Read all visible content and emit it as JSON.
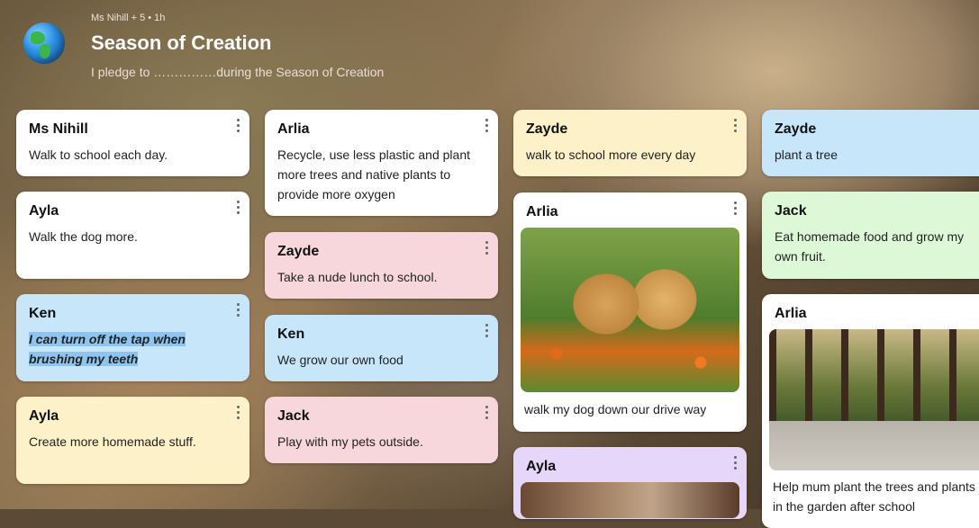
{
  "header": {
    "meta": "Ms Nihill + 5 • 1h",
    "title": "Season of Creation",
    "subtitle": "I pledge to ……………during the Season of Creation"
  },
  "columns": [
    [
      {
        "author": "Ms Nihill",
        "text": "Walk to school each day."
      },
      {
        "author": "Ayla",
        "text": "Walk the dog more."
      },
      {
        "author": "Ken",
        "text": "I can turn off the tap when brushing my teeth"
      },
      {
        "author": "Ayla",
        "text": "Create more homemade stuff."
      }
    ],
    [
      {
        "author": "Arlia",
        "text": "Recycle, use less plastic and plant more trees and native plants to provide more oxygen"
      },
      {
        "author": "Zayde",
        "text": "Take a nude lunch to school."
      },
      {
        "author": "Ken",
        "text": "We grow our own food"
      },
      {
        "author": "Jack",
        "text": "Play with my pets outside."
      }
    ],
    [
      {
        "author": "Zayde",
        "text": "walk to school more every day"
      },
      {
        "author": "Arlia",
        "text": "walk my dog down our drive way",
        "image": "photo of two golden retriever puppies"
      },
      {
        "author": "Ayla",
        "text": ""
      }
    ],
    [
      {
        "author": "Zayde",
        "text": "plant a tree"
      },
      {
        "author": "Jack",
        "text": "Eat homemade food and grow my own fruit."
      },
      {
        "author": "Arlia",
        "text": "Help mum plant the trees and plants in the garden after school",
        "image": "photo of tree-lined path"
      }
    ]
  ],
  "colors": {
    "white": "#ffffff",
    "yellow": "#fcf1c8",
    "pink": "#f7d7dc",
    "blue": "#c7e6fa",
    "green": "#dcf8d6",
    "purple": "#e6d7fa"
  }
}
